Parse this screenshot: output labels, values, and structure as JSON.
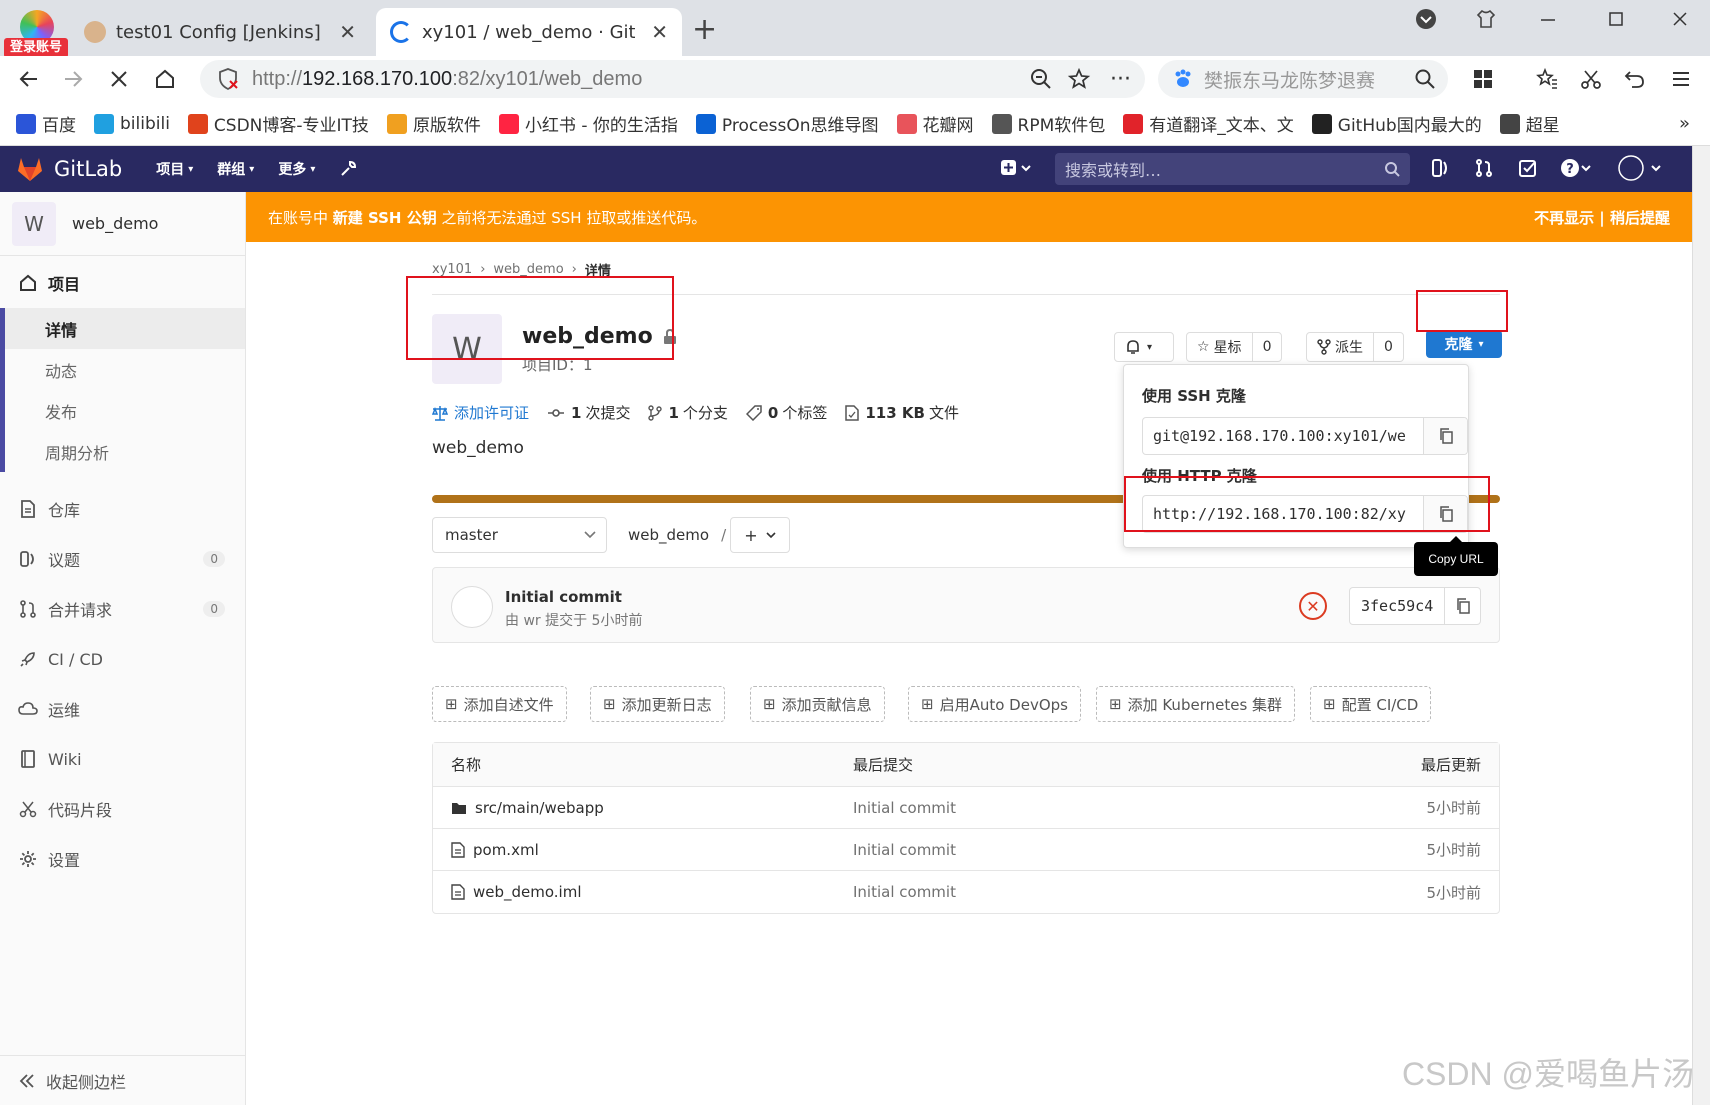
{
  "browser": {
    "login_badge": "登录账号",
    "tabs": [
      {
        "title": "test01 Config [Jenkins]",
        "active": false
      },
      {
        "title": "xy101 / web_demo · GitLab",
        "active": true
      }
    ],
    "url_prefix": "http://",
    "url_host": "192.168.170.100",
    "url_rest": ":82/xy101/web_demo",
    "search_text": "樊振东马龙陈梦退赛",
    "bookmarks": [
      {
        "label": "百度",
        "color": "#2b55d8"
      },
      {
        "label": "bilibili",
        "color": "#20a0e0"
      },
      {
        "label": "CSDN博客-专业IT技",
        "color": "#e0431c"
      },
      {
        "label": "原版软件",
        "color": "#f0a020"
      },
      {
        "label": "小红书 - 你的生活指",
        "color": "#ff2442"
      },
      {
        "label": "ProcessOn思维导图",
        "color": "#0b62d4"
      },
      {
        "label": "花瓣网",
        "color": "#e8545b"
      },
      {
        "label": "RPM软件包",
        "color": "#555555"
      },
      {
        "label": "有道翻译_文本、文",
        "color": "#e1232a"
      },
      {
        "label": "GitHub国内最大的",
        "color": "#222222"
      },
      {
        "label": "超星",
        "color": "#444444"
      }
    ],
    "more_bookmarks": "»"
  },
  "gitlab_header": {
    "brand": "GitLab",
    "nav": [
      "项目",
      "群组",
      "更多"
    ],
    "search_placeholder": "搜索或转到…"
  },
  "sidebar": {
    "project_initial": "W",
    "project_name": "web_demo",
    "section_project": "项目",
    "sub_items": [
      {
        "label": "详情",
        "active": true
      },
      {
        "label": "动态",
        "active": false
      },
      {
        "label": "发布",
        "active": false
      },
      {
        "label": "周期分析",
        "active": false
      }
    ],
    "items": [
      {
        "label": "仓库",
        "icon": "doc-icon"
      },
      {
        "label": "议题",
        "icon": "issues-icon",
        "count": "0"
      },
      {
        "label": "合并请求",
        "icon": "merge-request-icon",
        "count": "0"
      },
      {
        "label": "CI / CD",
        "icon": "rocket-icon"
      },
      {
        "label": "运维",
        "icon": "cloud-icon"
      },
      {
        "label": "Wiki",
        "icon": "book-icon"
      },
      {
        "label": "代码片段",
        "icon": "scissors-icon"
      },
      {
        "label": "设置",
        "icon": "gear-icon"
      }
    ],
    "collapse_label": "收起侧边栏"
  },
  "banner": {
    "text_pre": "在账号中 ",
    "text_bold": "新建 SSH 公钥",
    "text_post": " 之前将无法通过 SSH 拉取或推送代码。",
    "actions": "不再显示 | 稍后提醒"
  },
  "breadcrumb": {
    "group": "xy101",
    "project": "web_demo",
    "current": "详情"
  },
  "project": {
    "initial": "W",
    "name": "web_demo",
    "id_label": "项目ID：1",
    "star_label": "星标",
    "star_count": "0",
    "fork_label": "派生",
    "fork_count": "0",
    "clone_label": "克隆"
  },
  "stats": {
    "license": "添加许可证",
    "commits_num": "1",
    "commits_label": "次提交",
    "branches_num": "1",
    "branches_label": "个分支",
    "tags_num": "0",
    "tags_label": "个标签",
    "size_num": "113 KB",
    "size_label": "文件"
  },
  "description": "web_demo",
  "repo": {
    "branch": "master",
    "path": "web_demo",
    "path_sep": "/"
  },
  "last_commit": {
    "title": "Initial commit",
    "meta": "由 wr 提交于 5小时前",
    "sha": "3fec59c4"
  },
  "quick_actions": [
    "添加自述文件",
    "添加更新日志",
    "添加贡献信息",
    "启用Auto DevOps",
    "添加 Kubernetes 集群",
    "配置 CI/CD"
  ],
  "file_tree": {
    "headers": {
      "name": "名称",
      "commit": "最后提交",
      "date": "最后更新"
    },
    "rows": [
      {
        "name": "src/main/webapp",
        "type": "folder",
        "commit": "Initial commit",
        "date": "5小时前"
      },
      {
        "name": "pom.xml",
        "type": "file",
        "commit": "Initial commit",
        "date": "5小时前"
      },
      {
        "name": "web_demo.iml",
        "type": "file",
        "commit": "Initial commit",
        "date": "5小时前"
      }
    ]
  },
  "clone_dropdown": {
    "ssh_label": "使用 SSH 克隆",
    "ssh_url": "git@192.168.170.100:xy101/we",
    "http_label": "使用 HTTP 克隆",
    "http_url": "http://192.168.170.100:82/xy",
    "tooltip": "Copy URL"
  },
  "watermark": "CSDN @爱喝鱼片汤",
  "colors": {
    "gitlab_header": "#292961",
    "banner": "#fc9403",
    "clone_button": "#1f78d1",
    "highlight_box": "#e0121c",
    "language_bar": "#b07219"
  }
}
